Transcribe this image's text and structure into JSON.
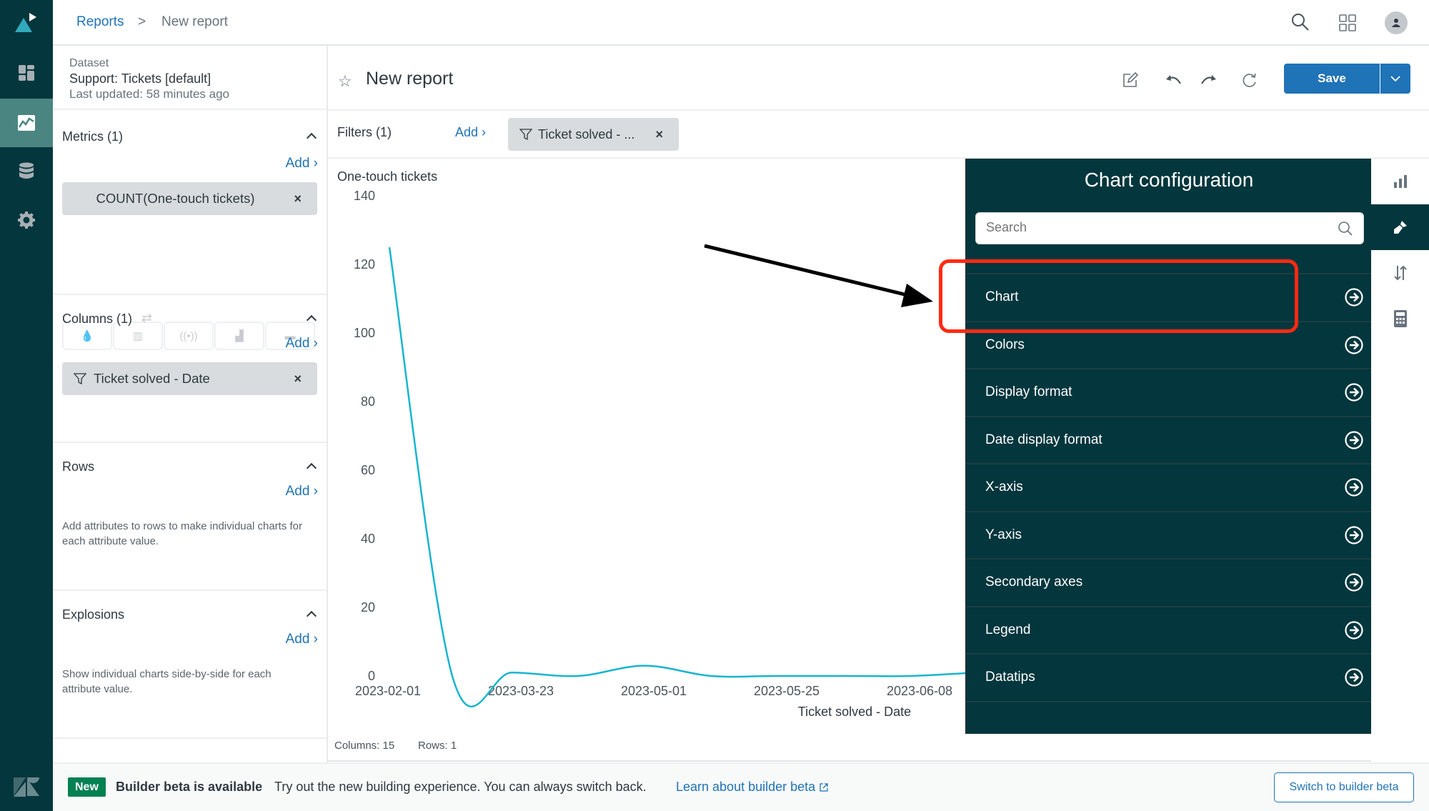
{
  "breadcrumb": {
    "root": "Reports",
    "separator": ">",
    "current": "New report"
  },
  "dataset": {
    "label": "Dataset",
    "name": "Support: Tickets [default]",
    "updated": "Last updated: 58 minutes ago"
  },
  "metrics": {
    "title": "Metrics (1)",
    "add": "Add ›",
    "items": [
      "COUNT(One-touch tickets)"
    ]
  },
  "columns": {
    "title": "Columns (1)",
    "add": "Add ›",
    "items": [
      "Ticket solved - Date"
    ]
  },
  "rows": {
    "title": "Rows",
    "add": "Add ›",
    "hint": "Add attributes to rows to make individual charts for each attribute value."
  },
  "explosions": {
    "title": "Explosions",
    "add": "Add ›",
    "hint": "Show individual charts side-by-side for each attribute value."
  },
  "report": {
    "title": "New report",
    "save": "Save"
  },
  "filters": {
    "title": "Filters (1)",
    "add": "Add ›",
    "chip": "Ticket solved - ..."
  },
  "footer_stats": {
    "columns": "Columns: 15",
    "rows": "Rows: 1"
  },
  "config": {
    "title": "Chart configuration",
    "search_placeholder": "Search",
    "items": [
      "Chart",
      "Colors",
      "Display format",
      "Date display format",
      "X-axis",
      "Y-axis",
      "Secondary axes",
      "Legend",
      "Datatips"
    ]
  },
  "banner": {
    "badge": "New",
    "headline": "Builder beta is available",
    "text": "Try out the new building experience. You can always switch back.",
    "link": "Learn about builder beta",
    "button": "Switch to builder beta"
  },
  "colors": {
    "nav": "#03363d",
    "accent": "#1f73b7",
    "line": "#17b5cf",
    "highlight": "#ff2a12",
    "badge": "#038153"
  },
  "chart_data": {
    "type": "line",
    "ylabel": "One-touch tickets",
    "xlabel": "Ticket solved - Date",
    "ylim": [
      0,
      140
    ],
    "yticks": [
      0,
      20,
      40,
      60,
      80,
      100,
      120,
      140
    ],
    "categories": [
      "2023-02-01",
      "2023-03-23",
      "2023-05-01",
      "2023-05-25",
      "2023-06-08"
    ],
    "series": [
      {
        "name": "COUNT(One-touch tickets)",
        "x_index": [
          0,
          0.5,
          1,
          1.5,
          2,
          2.5,
          3,
          3.5,
          4,
          4.5
        ],
        "values": [
          125,
          0,
          1,
          0,
          3,
          0,
          0,
          0,
          0,
          1
        ]
      }
    ],
    "grid": false,
    "legend": "none"
  }
}
